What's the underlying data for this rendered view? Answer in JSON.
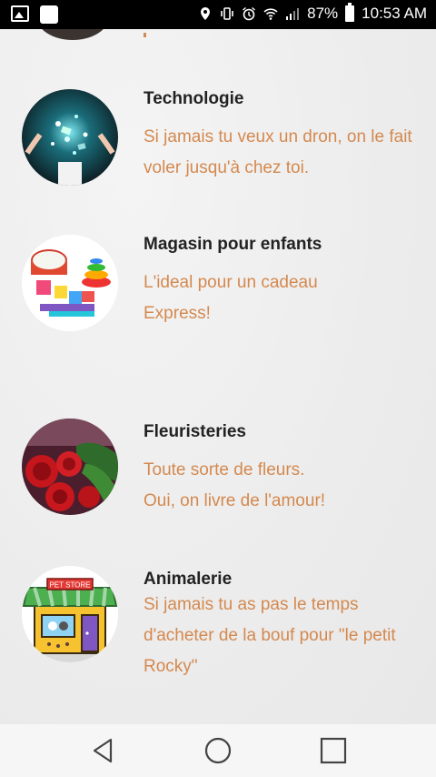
{
  "status_bar": {
    "battery": "87%",
    "time": "10:53 AM"
  },
  "categories": [
    {
      "title": "Technologie",
      "description": "Si jamais tu veux un dron, on le fait voler jusqu'à chez toi."
    },
    {
      "title": "Magasin pour enfants",
      "description_lines": [
        "L'ideal pour un cadeau",
        "Express!"
      ]
    },
    {
      "title": "Fleuristeries",
      "description_lines": [
        "Toute sorte de fleurs.",
        "Oui, on livre de l'amour!"
      ]
    },
    {
      "title": "Animalerie",
      "description": "Si jamais tu as pas le temps d'acheter de la bouf pour \"le petit Rocky\""
    }
  ],
  "pet_store_sign": "PET STORE",
  "colors": {
    "accent_text": "#d4894f",
    "title_text": "#222222"
  }
}
